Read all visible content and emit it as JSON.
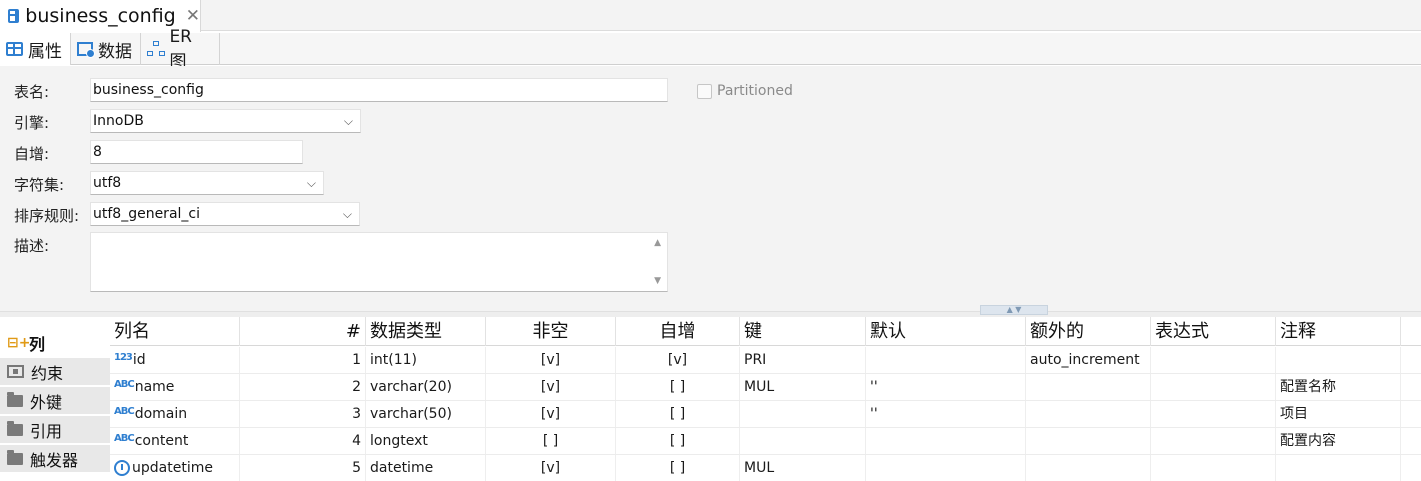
{
  "editor_tab": {
    "title": "business_config",
    "close_glyph": "✕",
    "icon": "table-icon"
  },
  "view_tabs": [
    {
      "label": "属性",
      "icon": "table-icon",
      "active": true
    },
    {
      "label": "数据",
      "icon": "data-icon",
      "active": false
    },
    {
      "label": "ER 图",
      "icon": "er-diagram-icon",
      "active": false
    }
  ],
  "form": {
    "table_name": {
      "label": "表名:",
      "value": "business_config"
    },
    "engine": {
      "label": "引擎:",
      "value": "InnoDB"
    },
    "auto_increment": {
      "label": "自增:",
      "value": "8"
    },
    "charset": {
      "label": "字符集:",
      "value": "utf8"
    },
    "collation": {
      "label": "排序规则:",
      "value": "utf8_general_ci"
    },
    "description": {
      "label": "描述:",
      "value": ""
    },
    "partitioned": {
      "label": "Partitioned",
      "checked": false
    }
  },
  "sections": [
    {
      "label": "列",
      "icon": "add-column-icon",
      "active": true
    },
    {
      "label": "约束",
      "icon": "constraint-icon",
      "active": false
    },
    {
      "label": "外键",
      "icon": "folder-icon",
      "active": false
    },
    {
      "label": "引用",
      "icon": "folder-icon",
      "active": false
    },
    {
      "label": "触发器",
      "icon": "folder-icon",
      "active": false
    }
  ],
  "columns_table": {
    "headers": {
      "name": "列名",
      "num": "#",
      "type": "数据类型",
      "not_null": "非空",
      "auto_inc": "自增",
      "key": "键",
      "default": "默认",
      "extra": "额外的",
      "expression": "表达式",
      "comment": "注释"
    },
    "rows": [
      {
        "icon_text": "123",
        "name": "id",
        "num": "1",
        "type": "int(11)",
        "not_null": "[v]",
        "auto_inc": "[v]",
        "key": "PRI",
        "default": "",
        "extra": "auto_increment",
        "expression": "",
        "comment": ""
      },
      {
        "icon_text": "ABC",
        "name": "name",
        "num": "2",
        "type": "varchar(20)",
        "not_null": "[v]",
        "auto_inc": "[ ]",
        "key": "MUL",
        "default": "''",
        "extra": "",
        "expression": "",
        "comment": "配置名称"
      },
      {
        "icon_text": "ABC",
        "name": "domain",
        "num": "3",
        "type": "varchar(50)",
        "not_null": "[v]",
        "auto_inc": "[ ]",
        "key": "",
        "default": "''",
        "extra": "",
        "expression": "",
        "comment": "项目"
      },
      {
        "icon_text": "ABC",
        "name": "content",
        "num": "4",
        "type": "longtext",
        "not_null": "[ ]",
        "auto_inc": "[ ]",
        "key": "",
        "default": "",
        "extra": "",
        "expression": "",
        "comment": "配置内容"
      },
      {
        "icon_text": "",
        "name": "updatetime",
        "num": "5",
        "type": "datetime",
        "not_null": "[v]",
        "auto_inc": "[ ]",
        "key": "MUL",
        "default": "",
        "extra": "",
        "expression": "",
        "comment": ""
      }
    ]
  },
  "colors": {
    "accent": "#2f7fd0",
    "add_icon": "#e09a16"
  }
}
